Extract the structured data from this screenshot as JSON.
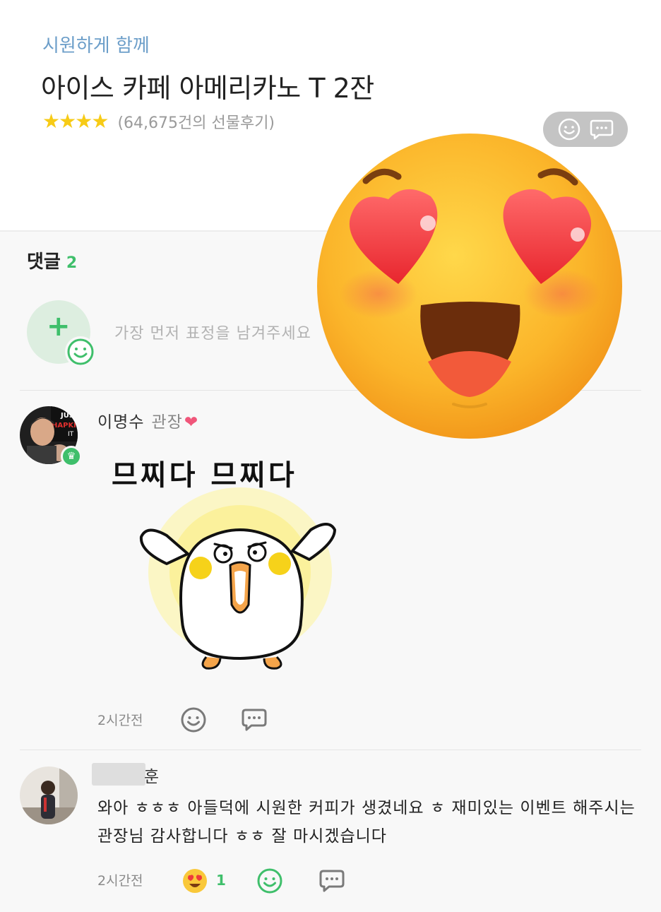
{
  "product": {
    "subtitle": "시원하게 함께",
    "title": "아이스 카페 아메리카노 T 2잔",
    "rating_stars": 4,
    "review_count_text": "(64,675건의 선물후기)"
  },
  "comments": {
    "header_label": "댓글",
    "count": "2",
    "add_prompt": "가장 먼저 표정을 남겨주세요",
    "items": [
      {
        "author": "이명수",
        "role": "관장",
        "role_emoji": "❤",
        "text": "므찌다 므찌다",
        "time": "2시간전"
      },
      {
        "author_visible_suffix": "훈",
        "text": "와아 ㅎㅎㅎ 아들덕에 시원한 커피가 생겼네요 ㅎ 재미있는 이벤트 해주시는 관장님 감사합니다 ㅎㅎ 잘 마시겠습니다",
        "time": "2시간전",
        "reaction_count": "1"
      }
    ]
  },
  "colors": {
    "accent_green": "#3fbf6b",
    "subtitle_blue": "#6c9ec9",
    "star_yellow": "#f7cb16"
  },
  "icons": [
    "smile-icon",
    "chat-bubble-icon",
    "plus-icon",
    "crown-icon",
    "heart-eyes-emoji",
    "sticker-chick"
  ]
}
